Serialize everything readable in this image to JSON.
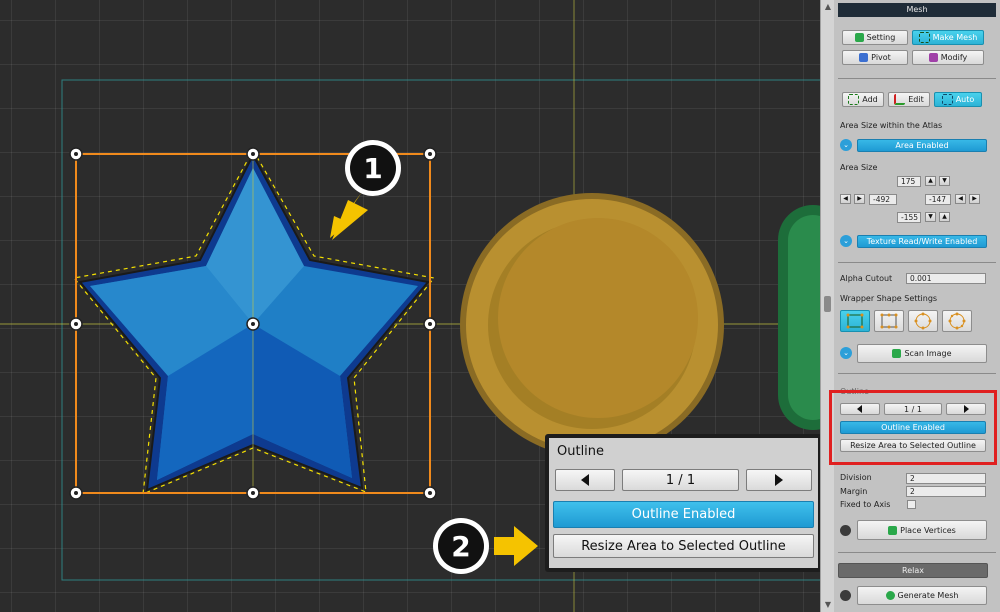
{
  "inspector": {
    "header": "Mesh",
    "tabs": {
      "setting": "Setting",
      "make_mesh": "Make Mesh",
      "pivot": "Pivot",
      "modify": "Modify"
    },
    "tools": {
      "add": "Add",
      "edit": "Edit",
      "auto": "Auto"
    },
    "area_size_atlas_label": "Area Size within the Atlas",
    "area_enabled": "Area Enabled",
    "area_size_label": "Area Size",
    "area": {
      "top": "175",
      "left": "-492",
      "right": "-147",
      "bottom": "-155"
    },
    "texture_rw": "Texture Read/Write Enabled",
    "alpha_cutout_label": "Alpha Cutout",
    "alpha_cutout_value": "0.001",
    "wrapper_shape_label": "Wrapper Shape Settings",
    "scan_image": "Scan Image",
    "outline_label": "Outline",
    "outline_page": "1 / 1",
    "outline_enabled": "Outline Enabled",
    "resize_area": "Resize Area to Selected Outline",
    "division_label": "Division",
    "division_value": "2",
    "margin_label": "Margin",
    "margin_value": "2",
    "fixed_axis_label": "Fixed to Axis",
    "place_vertices": "Place Vertices",
    "relax": "Relax",
    "generate_mesh": "Generate Mesh"
  },
  "callout": {
    "title": "Outline",
    "page": "1 / 1",
    "outline_enabled": "Outline Enabled",
    "resize_area": "Resize Area to Selected Outline"
  },
  "badges": {
    "one": "1",
    "two": "2"
  },
  "colors": {
    "accent_blue": "#1f9ad3",
    "active_cyan": "#2cb3d6",
    "highlight_red": "#e02020",
    "annotation_yellow": "#f5c300",
    "bbox_orange": "#f08a1c",
    "star_blue": "#1f7fc6",
    "coin_gold": "#b99030"
  }
}
